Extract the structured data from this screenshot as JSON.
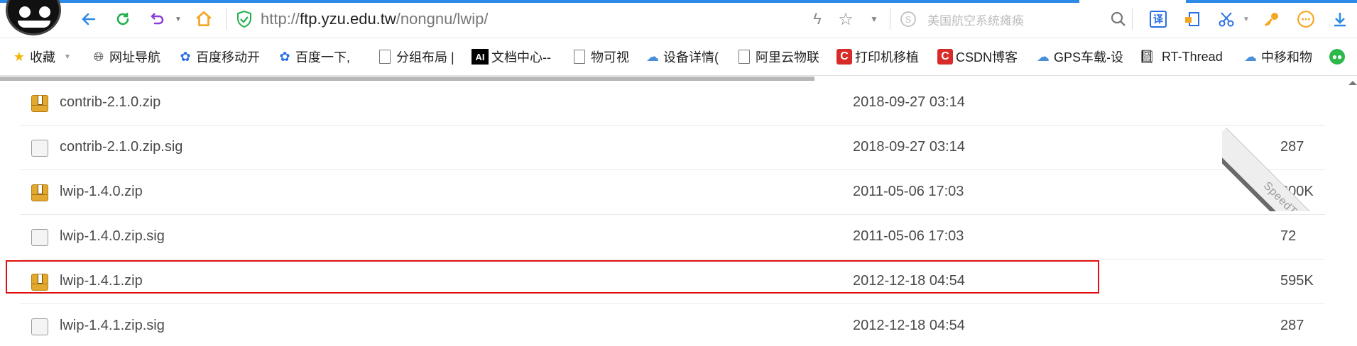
{
  "toolbar": {
    "url_prefix": "http://",
    "url_host": "ftp.yzu.edu.tw",
    "url_path": "/nongnu/lwip/",
    "search_placeholder": "美国航空系统瘫痪",
    "icons": [
      "back-arrow-icon",
      "refresh-icon",
      "undo-icon",
      "home-icon",
      "shield-check-icon",
      "lightning-icon",
      "star-icon",
      "chevron-down-icon",
      "search-engine-icon",
      "search-icon",
      "translate-icon",
      "sidebar-icon",
      "scissors-icon",
      "key-icon",
      "smiley-icon",
      "download-icon"
    ],
    "colors": {
      "accent": "#2a8ae6",
      "refresh": "#22b14c",
      "undo": "#8b3fd9",
      "home": "#f5a623"
    }
  },
  "bookmarks": [
    {
      "label": "收藏",
      "icon": "star-icon"
    },
    {
      "label": "网址导航",
      "icon": "globe-icon"
    },
    {
      "label": "百度移动开",
      "icon": "baidu-paw-icon"
    },
    {
      "label": "百度一下,",
      "icon": "baidu-paw-icon"
    },
    {
      "label": "分组布局 |",
      "icon": "page-icon"
    },
    {
      "label": "文档中心--",
      "icon": "ai-icon"
    },
    {
      "label": "物可视",
      "icon": "page-icon"
    },
    {
      "label": "设备详情(",
      "icon": "cloud-icon"
    },
    {
      "label": "阿里云物联",
      "icon": "page-icon"
    },
    {
      "label": "打印机移植",
      "icon": "csdn-icon"
    },
    {
      "label": "CSDN博客",
      "icon": "csdn-icon"
    },
    {
      "label": "GPS车载-设",
      "icon": "cloud-icon"
    },
    {
      "label": "RT-Thread",
      "icon": "book-icon"
    },
    {
      "label": "中移和物",
      "icon": "cloud-icon"
    }
  ],
  "files": [
    {
      "name": "contrib-2.1.0.zip",
      "date": "2018-09-27 03:14",
      "size": "",
      "type": "zip"
    },
    {
      "name": "contrib-2.1.0.zip.sig",
      "date": "2018-09-27 03:14",
      "size": "287",
      "type": "generic"
    },
    {
      "name": "lwip-1.4.0.zip",
      "date": "2011-05-06 17:03",
      "size": "600K",
      "type": "zip"
    },
    {
      "name": "lwip-1.4.0.zip.sig",
      "date": "2011-05-06 17:03",
      "size": "72",
      "type": "generic"
    },
    {
      "name": "lwip-1.4.1.zip",
      "date": "2012-12-18 04:54",
      "size": "595K",
      "type": "zip",
      "highlighted": true
    },
    {
      "name": "lwip-1.4.1.zip.sig",
      "date": "2012-12-18 04:54",
      "size": "287",
      "type": "generic"
    }
  ],
  "ribbon": {
    "label": "SpeedTest"
  },
  "highlight_color": "#e01010"
}
